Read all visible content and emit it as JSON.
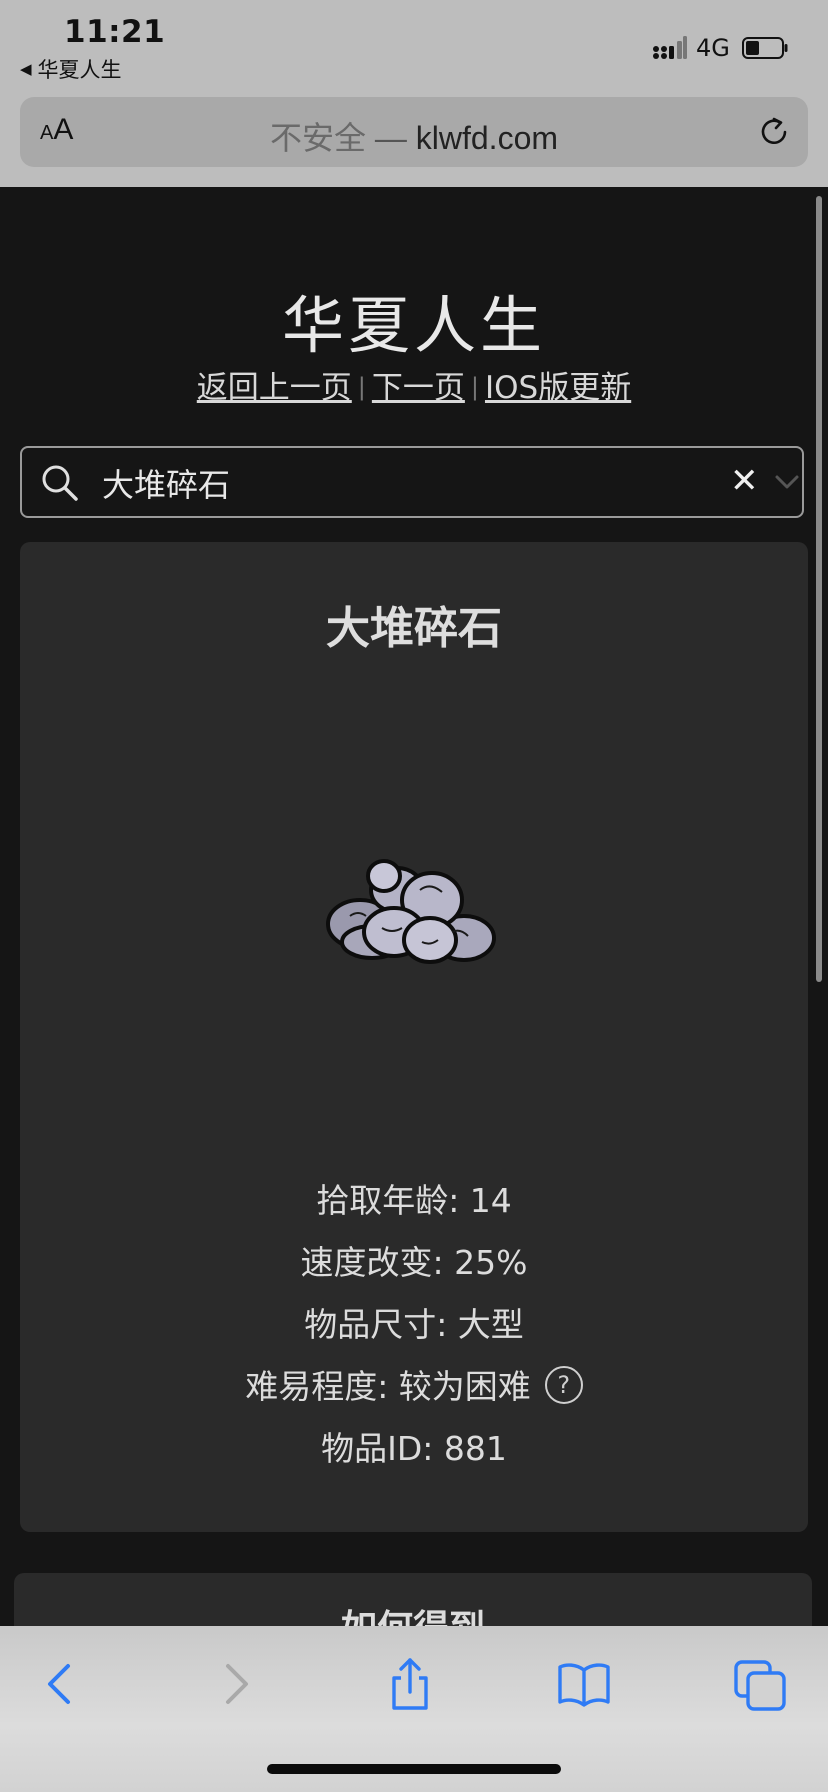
{
  "status_bar": {
    "time": "11:21",
    "back_app": "华夏人生",
    "network": "4G"
  },
  "browser": {
    "aa_small": "A",
    "aa_large": "A",
    "insecure_label": "不安全",
    "url_separator": " — ",
    "domain": "klwfd.com"
  },
  "header": {
    "site_title": "华夏人生",
    "nav": {
      "back": "返回上一页",
      "next": "下一页",
      "ios_update": "IOS版更新",
      "separator": "|"
    }
  },
  "search": {
    "value": "大堆碎石",
    "clear_glyph": "✕"
  },
  "item": {
    "name": "大堆碎石",
    "details": {
      "pickup_age": "拾取年龄: 14",
      "speed_change": "速度改变: 25%",
      "size": "物品尺寸: 大型",
      "difficulty": "难易程度: 较为困难",
      "item_id": "物品ID: 881"
    },
    "help_glyph": "?"
  },
  "howto": {
    "title": "如何得到"
  },
  "colors": {
    "page_bg": "#151515",
    "card_bg": "#2a2a2a",
    "toolbar_icon": "#2f7bf5",
    "chrome_bg": "#bdbdbd"
  },
  "icons": {
    "toolbar": [
      "back-arrow-icon",
      "forward-arrow-icon",
      "share-icon",
      "bookmarks-icon",
      "tabs-icon"
    ]
  }
}
